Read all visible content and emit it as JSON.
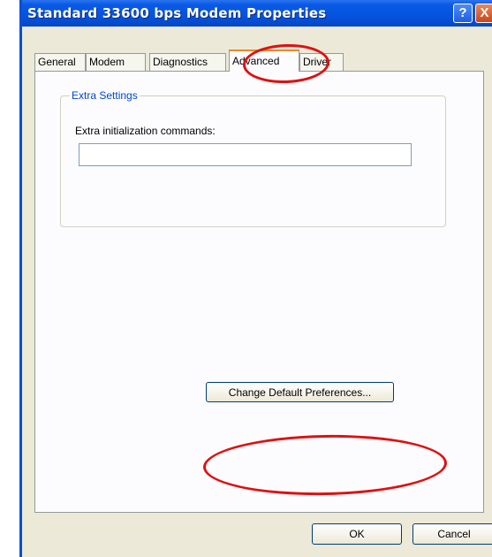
{
  "window": {
    "title": "Standard 33600 bps Modem Properties",
    "help_glyph": "?",
    "close_glyph": "X"
  },
  "tabs": [
    {
      "label": "General"
    },
    {
      "label": "Modem"
    },
    {
      "label": "Diagnostics"
    },
    {
      "label": "Advanced",
      "active": true
    },
    {
      "label": "Driver"
    }
  ],
  "extra_settings": {
    "group_title": "Extra Settings",
    "field_label": "Extra initialization commands:",
    "field_value": ""
  },
  "buttons": {
    "change_defaults": "Change Default Preferences...",
    "ok": "OK",
    "cancel": "Cancel"
  },
  "annotation_color": "#e01010"
}
